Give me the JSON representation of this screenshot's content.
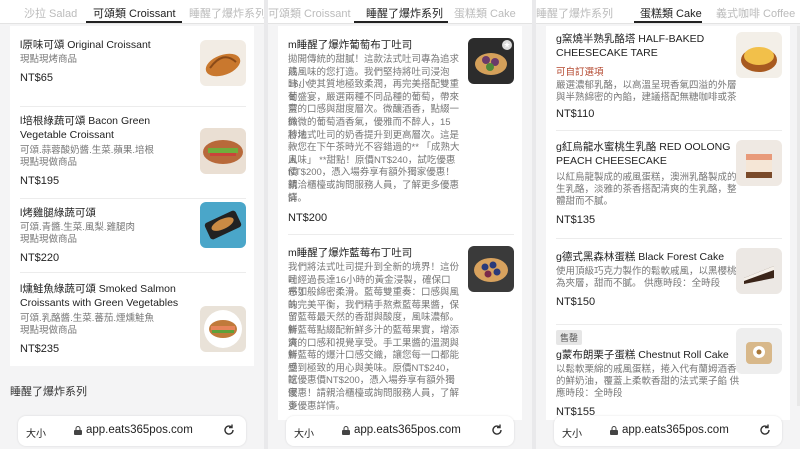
{
  "panel1": {
    "tabs": [
      "沙拉 Salad",
      "可頌類 Croissant",
      "睡醒了爆炸系列"
    ],
    "items": [
      {
        "title": "l原味可頌 Original Croissant",
        "desc": [
          "現點現烤商品"
        ],
        "price": "NT$65",
        "image": "croissant-photo"
      },
      {
        "title": "l培根綠蔬可頌 Bacon Green",
        "title2": "Vegetable Croissant",
        "desc": [
          "可頌.蒜蓉酸奶醬.生菜.蘋果.培根",
          "現點現做商品"
        ],
        "price": "NT$195",
        "image": "bacon-croissant-photo"
      },
      {
        "title": "l烤雞腿綠蔬可頌",
        "desc": [
          "可頌.青醬.生菜.風梨.雞腿肉",
          "現點現做商品"
        ],
        "price": "NT$220",
        "image": "chicken-croissant-photo"
      },
      {
        "title": "l燻鮭魚綠蔬可頌 Smoked Salmon",
        "title2": "Croissants with Green Vegetables",
        "desc": [
          "可頌.乳酪醬.生菜.蕃茄.煙燻鮭魚",
          "現點現做商品"
        ],
        "price": "NT$235",
        "image": "salmon-croissant-photo"
      }
    ],
    "section": "睡醒了爆炸系列"
  },
  "panel2": {
    "tabs": [
      "可頌類 Croissant",
      "睡醒了爆炸系列",
      "蛋糕類 Cake"
    ],
    "items": [
      {
        "title": "m睡醒了爆炸葡萄布丁吐司",
        "desc": [
          "拋開傳統的甜膩！這款法式吐司專為追求成",
          "熟風味的您打造。我們堅持將吐司浸泡16小",
          "時，使其質地極致柔潤，再完美搭配雙重葡",
          "萄盛宴，嚴選兩種不同品種的葡萄，帶來豐",
          "富的口感與甜度層次。微釀酒香，點綴一絲",
          "微微的葡萄酒香氣，優雅而不醉人，15秒地",
          "將法式吐司的奶香提升到更高層次。這是一",
          "款您在下午茶時光不容錯過的** 「成熟大人",
          "風味」 **甜點！原價NT$240，試吃優惠價",
          "NT$200，憑入場券享有額外獨家優惠！請",
          "親洽櫃檯或詢問服務人員，了解更多優惠詳",
          "情。"
        ],
        "price": "NT$200",
        "image": "grape-toast-photo"
      },
      {
        "title": "m睡醒了爆炸藍莓布丁吐司",
        "desc": [
          "我們將法式吐司提升到全新的境界！這份吐",
          "司經過長達16小時的黃金浸製，確保口感如",
          "布丁般綿密柔滑。藍莓雙重奏：口感與風味",
          "的完美平衡，我們精手熬煮藍莓果醬，保留",
          "了藍莓最天然的香甜與酸度，風味濃郁。新",
          "鮮藍莓點綴配新鮮多汁的藍莓果實，增添清",
          "爽的口感和視覺享受。手工果醬的溫潤與新",
          "鮮藍莓的爆汁口感交織，讓您每一口都能感",
          "受到極致的用心與美味。原價NT$240，試",
          "吃優惠價NT$200，憑入場券享有額外獨家",
          "優惠！請親洽櫃檯或詢問服務人員，了解更",
          "多優惠詳情。"
        ],
        "image": "blueberry-toast-photo"
      }
    ]
  },
  "panel3": {
    "tabs": [
      "睡醒了爆炸系列",
      "蛋糕類 Cake",
      "義式咖啡 Coffee"
    ],
    "items": [
      {
        "title": "g窯燒半熟乳酪塔 HALF-BAKED",
        "title2": "CHEESECAKE TARE",
        "tag": "可自訂選項",
        "desc": [
          "嚴選濃郁乳酪，以高溫呈現香氣四溢的外層",
          "與半熟綿密的內餡，建議搭配無糖咖啡或茶"
        ],
        "price": "NT$110",
        "image": "cheese-tart-photo"
      },
      {
        "title": "g紅烏龍水蜜桃生乳酪 RED OOLONG",
        "title2": "PEACH CHEESECAKE",
        "desc": [
          "以紅烏龍製成的戚風蛋糕，澳洲乳酪製成的",
          "生乳酪，淡雅的茶香搭配清爽的生乳酪，整",
          "體甜而不膩。"
        ],
        "price": "NT$135",
        "image": "peach-cheesecake-photo"
      },
      {
        "title": "g德式黑森林蛋糕 Black Forest Cake",
        "desc": [
          "使用頂級巧克力製作的鬆軟戚風，以黑櫻桃",
          "為夾層，甜而不膩。 供應時段：全時段"
        ],
        "price": "NT$150",
        "image": "black-forest-photo"
      },
      {
        "badge": "售罄",
        "title": "g蒙布朗栗子蛋糕 Chestnut Roll Cake",
        "desc": [
          "以鬆軟栗綿的戚風蛋糕，捲入代有蘭姆酒香",
          "的鮮奶油，覆蓋上柔軟香甜的法式栗子餡 供",
          "應時段：全時段"
        ],
        "price": "NT$155",
        "image": "chestnut-roll-photo"
      }
    ]
  },
  "browser": {
    "text_size": "大小",
    "url": "app.eats365pos.com"
  }
}
